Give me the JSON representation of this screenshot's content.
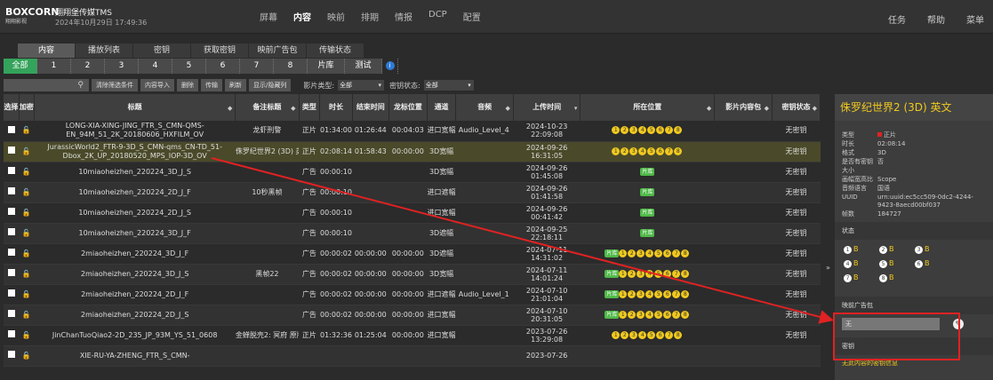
{
  "header": {
    "logo": "BOXCORN",
    "logo_sub": "翔翔影视",
    "app_title": "翔翔堡传媒TMS",
    "datetime": "2024年10月29日 17:49:36",
    "nav": [
      "屏幕",
      "内容",
      "映前",
      "排期",
      "情报",
      "DCP",
      "配置"
    ],
    "active_nav": "内容",
    "right_nav": [
      "任务",
      "帮助",
      "菜单"
    ]
  },
  "subtabs": [
    "内容",
    "播放列表",
    "密钥",
    "获取密钥",
    "映前广告包",
    "传输状态"
  ],
  "numtabs": [
    "全部",
    "1",
    "2",
    "3",
    "4",
    "5",
    "6",
    "7",
    "8",
    "片库",
    "测试"
  ],
  "toolbar": {
    "buttons": [
      "清除筛选条件",
      "内容导入",
      "删除",
      "传输",
      "刷新",
      "显示/隐藏列"
    ],
    "filter_type_label": "影片类型:",
    "filter_type_value": "全部",
    "filter_key_label": "密钥状态:",
    "filter_key_value": "全部"
  },
  "columns": [
    "选择",
    "加密",
    "标题",
    "备注标题",
    "类型",
    "时长",
    "结束时间",
    "龙标位置",
    "通道",
    "音频",
    "上传时间",
    "所在位置",
    "影片内容包",
    "密钥状态"
  ],
  "rows": [
    {
      "title": "LONG-XIA-XING-JING_FTR_S_CMN-QMS-EN_94M_51_2K_20180606_HXFILM_OV",
      "note": "龙虾刑警",
      "type": "正片",
      "duration": "01:34:00",
      "end": "01:26:44",
      "mark": "00:04:03",
      "channel": "进口宽幅",
      "audio": "Audio_Level_4",
      "date": "2024-10-23",
      "time": "22:09:08",
      "loc": "12345678",
      "key": "无密钥"
    },
    {
      "title": "JurassicWorld2_FTR-9-3D_S_CMN-qms_CN-TD_51-Dbox_2K_UP_20180520_MPS_IOP-3D_OV",
      "note": "侏罗纪世界2 (3D) 英文",
      "type": "正片",
      "duration": "02:08:14",
      "end": "01:58:43",
      "mark": "00:00:00",
      "channel": "3D宽幅",
      "audio": "",
      "date": "2024-09-26",
      "time": "16:31:05",
      "loc": "12345678",
      "key": "无密钥"
    },
    {
      "title": "10miaoheizhen_220224_3D_J_S",
      "note": "",
      "type": "广告",
      "duration": "00:00:10",
      "end": "",
      "mark": "",
      "channel": "3D宽幅",
      "audio": "",
      "date": "2024-09-26",
      "time": "01:45:08",
      "loc": "片库",
      "key": "无密钥"
    },
    {
      "title": "10miaoheizhen_220224_2D_J_F",
      "note": "10秒黑帧",
      "type": "广告",
      "duration": "00:00:10",
      "end": "",
      "mark": "",
      "channel": "进口遮幅",
      "audio": "",
      "date": "2024-09-26",
      "time": "01:41:58",
      "loc": "片库",
      "key": "无密钥"
    },
    {
      "title": "10miaoheizhen_220224_2D_J_S",
      "note": "",
      "type": "广告",
      "duration": "00:00:10",
      "end": "",
      "mark": "",
      "channel": "进口宽幅",
      "audio": "",
      "date": "2024-09-26",
      "time": "00:41:42",
      "loc": "片库",
      "key": "无密钥"
    },
    {
      "title": "10miaoheizhen_220224_3D_J_F",
      "note": "",
      "type": "广告",
      "duration": "00:00:10",
      "end": "",
      "mark": "",
      "channel": "3D遮幅",
      "audio": "",
      "date": "2024-09-25",
      "time": "22:18:11",
      "loc": "片库",
      "key": "无密钥"
    },
    {
      "title": "2miaoheizhen_220224_3D_J_F",
      "note": "",
      "type": "广告",
      "duration": "00:00:02",
      "end": "00:00:00",
      "mark": "00:00:00",
      "channel": "3D遮幅",
      "audio": "",
      "date": "2024-07-11",
      "time": "14:31:02",
      "loc": "片库12345678",
      "key": "无密钥"
    },
    {
      "title": "2miaoheizhen_220224_3D_J_S",
      "note": "黑帧22",
      "type": "广告",
      "duration": "00:00:02",
      "end": "00:00:00",
      "mark": "00:00:00",
      "channel": "3D宽幅",
      "audio": "",
      "date": "2024-07-11",
      "time": "14:01:24",
      "loc": "片库12345678",
      "key": "无密钥"
    },
    {
      "title": "2miaoheizhen_220224_2D_J_F",
      "note": "",
      "type": "广告",
      "duration": "00:00:02",
      "end": "00:00:00",
      "mark": "00:00:00",
      "channel": "进口遮幅",
      "audio": "Audio_Level_1",
      "date": "2024-07-10",
      "time": "21:01:04",
      "loc": "片库12345678",
      "key": "无密钥"
    },
    {
      "title": "2miaoheizhen_220224_2D_J_S",
      "note": "",
      "type": "广告",
      "duration": "00:00:02",
      "end": "00:00:00",
      "mark": "00:00:00",
      "channel": "进口宽幅",
      "audio": "",
      "date": "2024-07-10",
      "time": "20:31:05",
      "loc": "片库12345678",
      "key": "无密钥"
    },
    {
      "title": "JinChanTuoQiao2-2D_235_JP_93M_YS_51_0608",
      "note": "金蝉脱壳2: 冥府 原版",
      "type": "正片",
      "duration": "01:32:36",
      "end": "01:25:04",
      "mark": "00:00:00",
      "channel": "进口宽幅",
      "audio": "",
      "date": "2023-07-26",
      "time": "13:29:08",
      "loc": "12345678",
      "key": "无密钥"
    },
    {
      "title": "XIE-RU-YA-ZHENG_FTR_S_CMN-",
      "note": "",
      "type": "",
      "duration": "",
      "end": "",
      "mark": "",
      "channel": "",
      "audio": "",
      "date": "2023-07-26",
      "time": "",
      "loc": "",
      "key": ""
    }
  ],
  "panel": {
    "title": "侏罗纪世界2 (3D) 英文",
    "fields": [
      {
        "k": "类型",
        "v": "正片"
      },
      {
        "k": "时长",
        "v": "02:08:14"
      },
      {
        "k": "格式",
        "v": "3D"
      },
      {
        "k": "是否有密钥",
        "v": "否"
      },
      {
        "k": "大小",
        "v": ""
      },
      {
        "k": "画幅宽高比",
        "v": "Scope"
      },
      {
        "k": "音频语言",
        "v": "国语"
      },
      {
        "k": "UUID",
        "v": "urn:uuid:ec5cc509-0dc2-4244-9423-8aecd00bf037"
      },
      {
        "k": "帧数",
        "v": "184727"
      }
    ],
    "status_label": "状态",
    "status_items": [
      "1",
      "2",
      "3",
      "4",
      "5",
      "6",
      "7",
      "8"
    ],
    "status_value": "B",
    "ad_label": "映前广告包",
    "ad_value": "无",
    "key_label": "密钥",
    "no_key_text": "无此内容的密钥信息"
  }
}
